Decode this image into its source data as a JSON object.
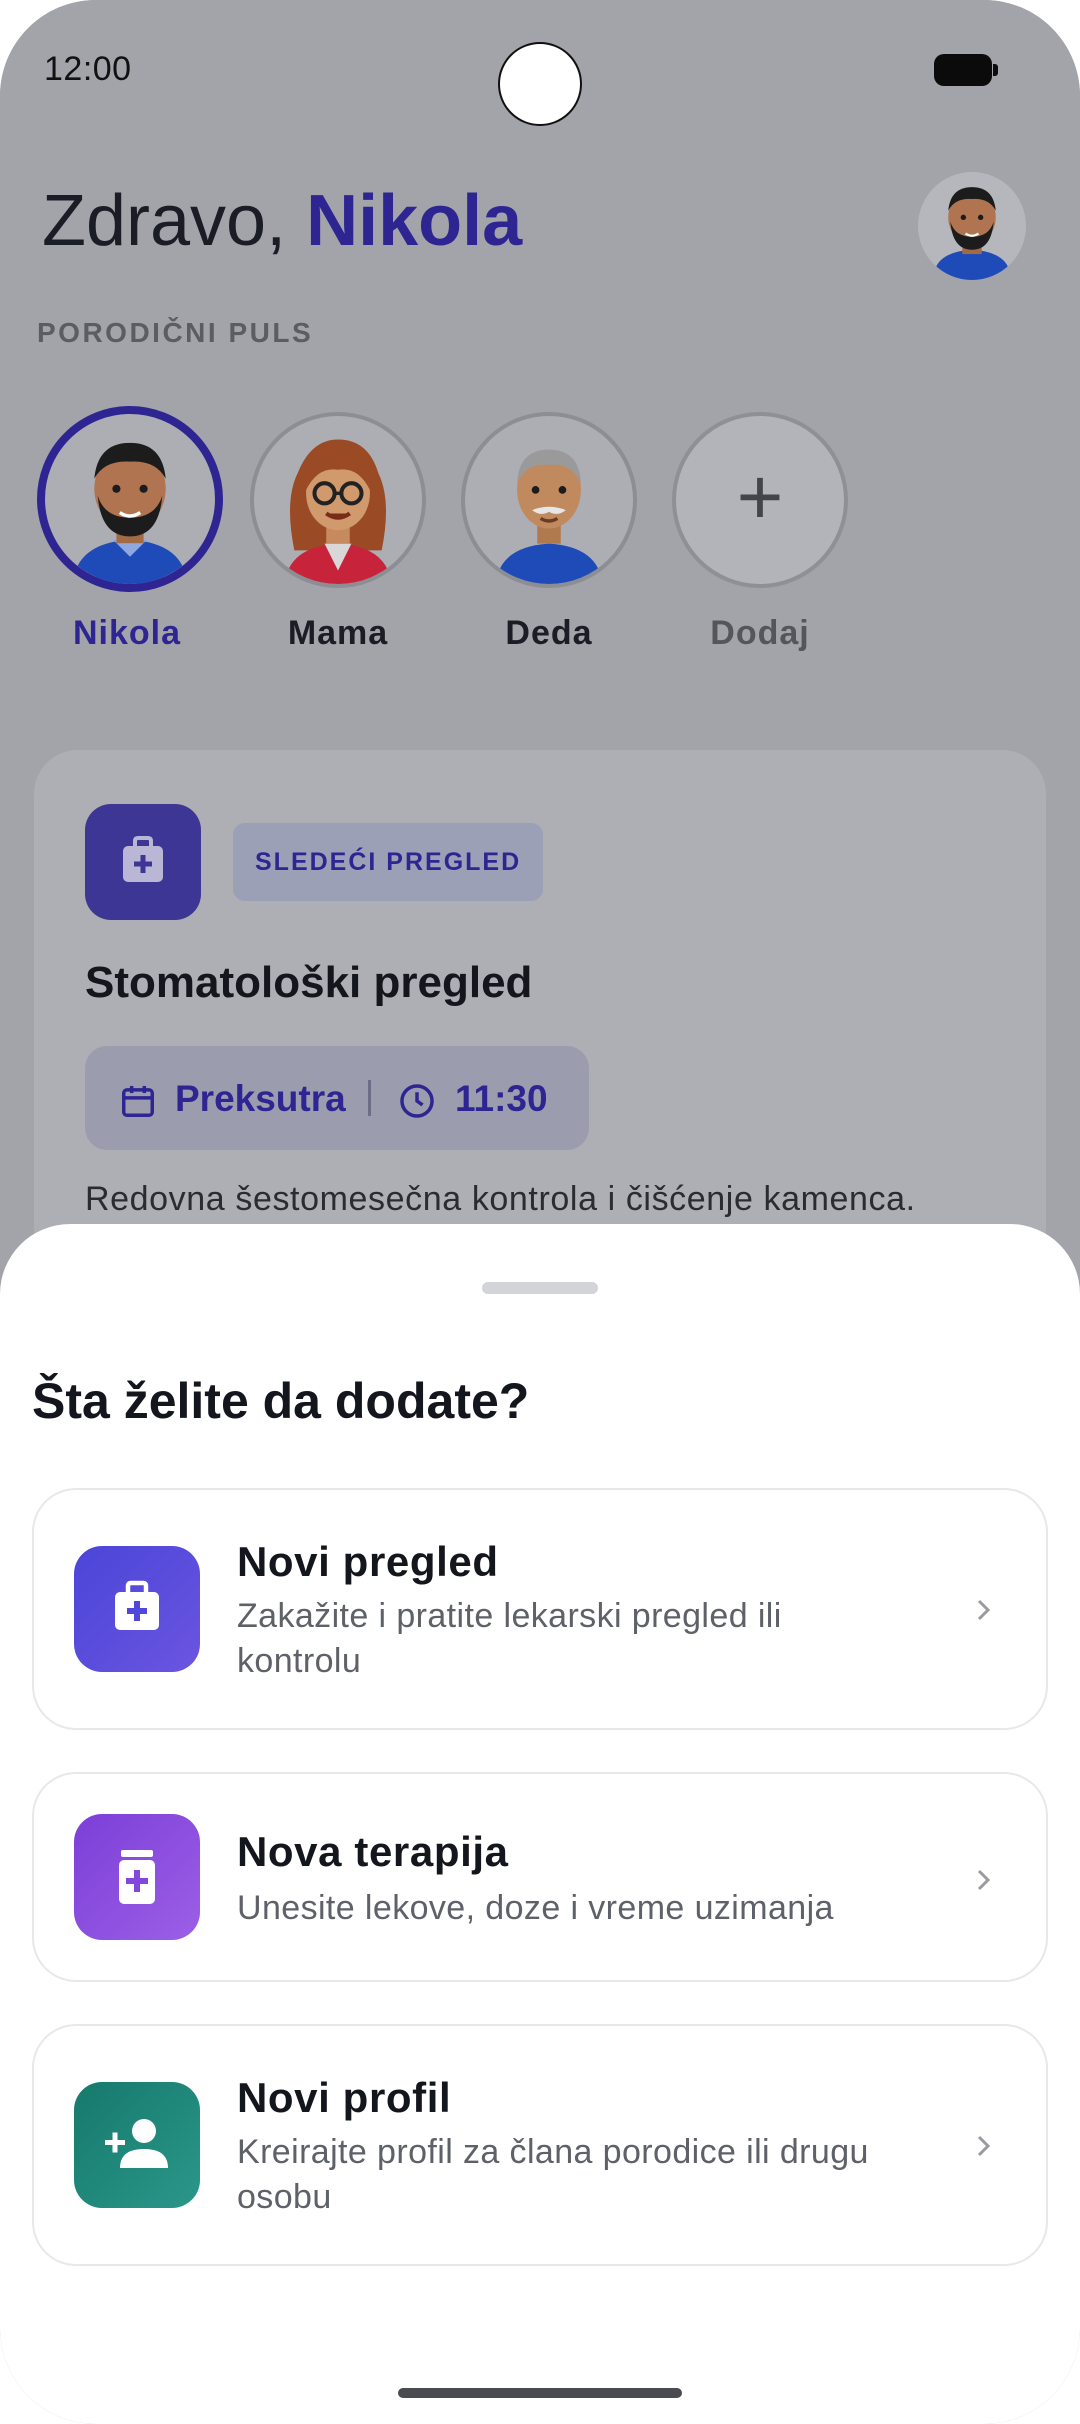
{
  "status_bar": {
    "time": "12:00"
  },
  "header": {
    "greeting_prefix": "Zdravo, ",
    "user_name": "Nikola"
  },
  "family": {
    "section_label": "PORODIČNI PULS",
    "members": [
      {
        "name": "Nikola",
        "active": true
      },
      {
        "name": "Mama"
      },
      {
        "name": "Deda"
      }
    ],
    "add_label": "Dodaj",
    "add_icon": "plus-icon"
  },
  "next_appointment": {
    "icon": "medical-kit-icon",
    "badge": "SLEDEĆI PREGLED",
    "title": "Stomatološki pregled",
    "date": "Preksutra",
    "time": "11:30",
    "description": "Redovna šestomesečna kontrola i čišćenje kamenca."
  },
  "sheet": {
    "title": "Šta želite da dodate?",
    "options": [
      {
        "title": "Novi pregled",
        "description": "Zakažite i pratite lekarski pregled ili kontrolu",
        "icon": "medical-kit-icon",
        "color": "#4f46d6"
      },
      {
        "title": "Nova terapija",
        "description": "Unesite lekove, doze i vreme uzimanja",
        "icon": "pill-bottle-icon",
        "color": "#8b4fe0"
      },
      {
        "title": "Novi profil",
        "description": "Kreirajte profil za člana porodice ili drugu osobu",
        "icon": "add-person-icon",
        "color": "#1f8a79"
      }
    ]
  }
}
